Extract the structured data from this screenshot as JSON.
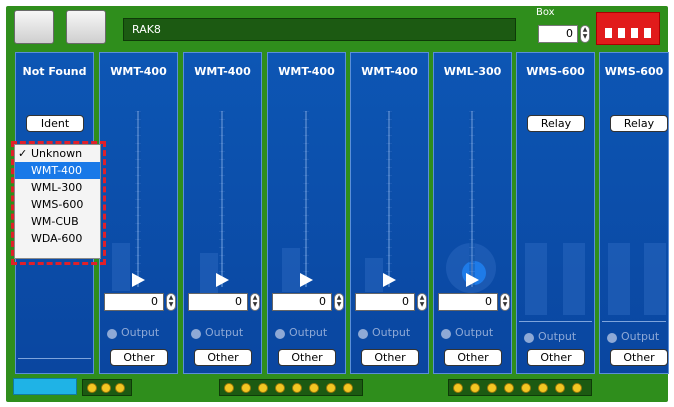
{
  "rack": {
    "name": "RAK8",
    "box_label": "Box",
    "box_value": "0"
  },
  "slots": [
    {
      "title": "Not Found",
      "button": "Ident",
      "has_fader": false
    },
    {
      "title": "WMT-400",
      "fader_value": "0",
      "output": "Output",
      "other": "Other"
    },
    {
      "title": "WMT-400",
      "fader_value": "0",
      "output": "Output",
      "other": "Other"
    },
    {
      "title": "WMT-400",
      "fader_value": "0",
      "output": "Output",
      "other": "Other"
    },
    {
      "title": "WMT-400",
      "fader_value": "0",
      "output": "Output",
      "other": "Other"
    },
    {
      "title": "WML-300",
      "fader_value": "0",
      "output": "Output",
      "other": "Other"
    },
    {
      "title": "WMS-600",
      "button": "Relay",
      "output": "Output",
      "other": "Other"
    },
    {
      "title": "WMS-600",
      "button": "Relay",
      "output": "Output",
      "other": "Other"
    }
  ],
  "dropdown": {
    "checkmark": "✓",
    "items": [
      "Unknown",
      "WMT-400",
      "WML-300",
      "WMS-600",
      "WM-CUB",
      "WDA-600"
    ],
    "checked_index": 0,
    "highlighted_index": 1
  },
  "colors": {
    "rack_green": "#2f8e1c",
    "slot_blue": "#0d56b4",
    "highlight": "#1979e8",
    "dashed_outline": "#e0202a",
    "led_yellow": "#f3c623"
  }
}
